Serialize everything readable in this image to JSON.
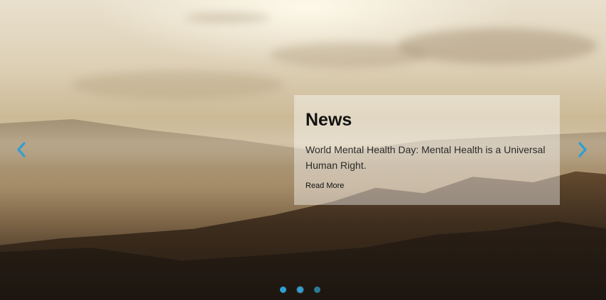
{
  "slide": {
    "title": "News",
    "text": "World Mental Health Day: Mental Health is a Universal Human Right.",
    "link_label": "Read More"
  },
  "controls": {
    "prev_icon": "chevron-left-icon",
    "next_icon": "chevron-right-icon",
    "accent_color": "#2f9fd3",
    "dot_count": 3,
    "active_dot": 1,
    "dot_colors": [
      "#2f9fd3",
      "#2f9fd3",
      "#2b7a95"
    ]
  }
}
